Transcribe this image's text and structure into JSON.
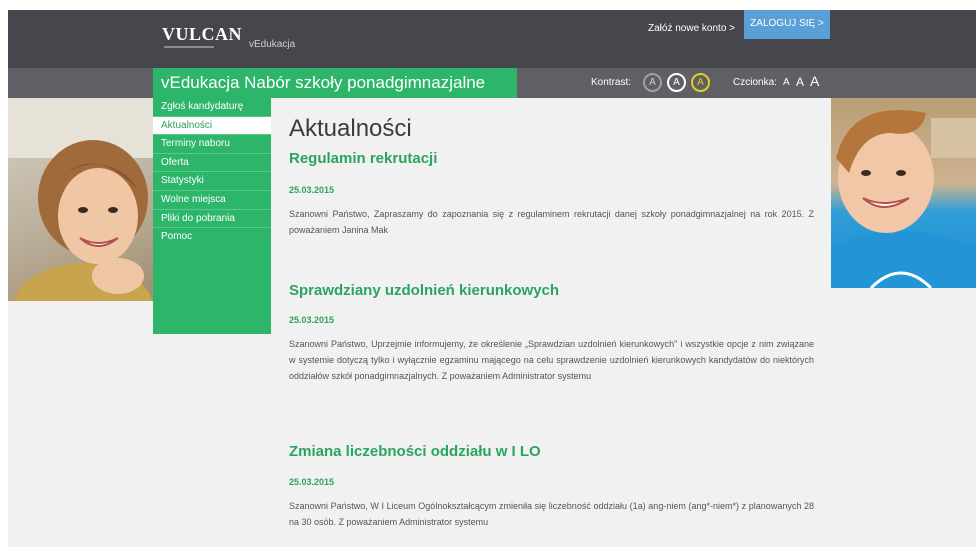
{
  "header": {
    "logo": "VULCAN",
    "app_name": "vEdukacja",
    "new_account": "Załóż nowe konto >",
    "login": "ZALOGUJ SIĘ >"
  },
  "subbar": {
    "title": "vEdukacja Nabór szkoły ponadgimnazjalne",
    "contrast_label": "Kontrast:",
    "contrast_options": [
      "A",
      "A",
      "A"
    ],
    "font_label": "Czcionka:",
    "font_sizes": [
      "A",
      "A",
      "A"
    ]
  },
  "sidebar": {
    "items": [
      {
        "label": "Zgłoś kandydaturę"
      },
      {
        "label": "Aktualności"
      },
      {
        "label": "Terminy naboru"
      },
      {
        "label": "Oferta"
      },
      {
        "label": "Statystyki"
      },
      {
        "label": "Wolne miejsca"
      },
      {
        "label": "Pliki do pobrania"
      },
      {
        "label": "Pomoc"
      }
    ],
    "active_index": 1
  },
  "main": {
    "title": "Aktualności",
    "news": [
      {
        "title": "Regulamin rekrutacji",
        "date": "25.03.2015",
        "body": "Szanowni Państwo, Zapraszamy do zapoznania się z regulaminem rekrutacji danej szkoły ponadgimnazjalnej na rok 2015. Z poważaniem Janina Mak"
      },
      {
        "title": "Sprawdziany uzdolnień kierunkowych",
        "date": "25.03.2015",
        "body": "Szanowni Państwo, Uprzejmie informujemy, że określenie „Sprawdzian uzdolnień kierunkowych\" i wszystkie opcje z nim związane w systemie dotyczą tylko i wyłącznie egzaminu mającego na celu sprawdzenie uzdolnień kierunkowych kandydatów do niektórych oddziałów szkół ponadgimnazjalnych. Z poważaniem Administrator systemu"
      },
      {
        "title": "Zmiana liczebności oddziału w I LO",
        "date": "25.03.2015",
        "body": "Szanowni Państwo, W I Liceum Ogólnokształcącym zmieniła się liczebność oddziału (1a) ang-niem (ang*-niem*) z planowanych 28 na 30 osób. Z poważaniem Administrator systemu"
      }
    ]
  },
  "colors": {
    "brand_green": "#2db56a",
    "header_dark": "#45474c",
    "login_blue": "#5b9fd8",
    "contrast_yellow": "#e3cf1e"
  },
  "icons": [
    "photo-girl",
    "photo-boy"
  ]
}
